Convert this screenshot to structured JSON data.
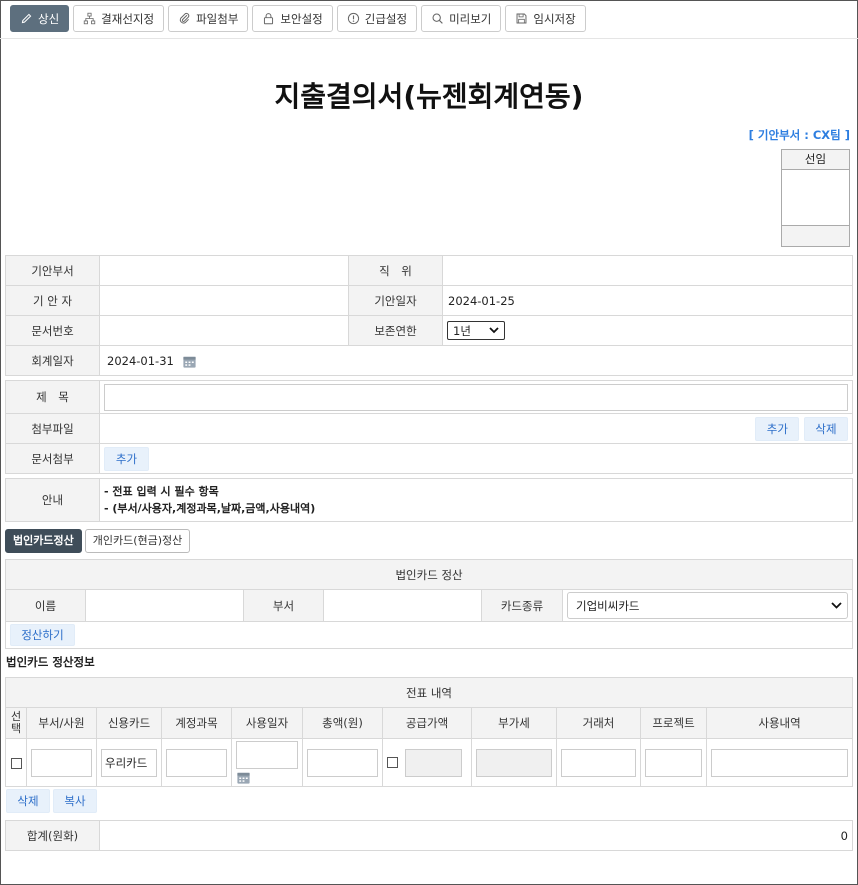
{
  "toolbar": {
    "buttons": [
      {
        "label": "상신",
        "icon": "pencil-icon"
      },
      {
        "label": "결재선지정",
        "icon": "org-chart-icon"
      },
      {
        "label": "파일첨부",
        "icon": "paperclip-icon"
      },
      {
        "label": "보안설정",
        "icon": "lock-icon"
      },
      {
        "label": "긴급설정",
        "icon": "alert-icon"
      },
      {
        "label": "미리보기",
        "icon": "search-icon"
      },
      {
        "label": "임시저장",
        "icon": "save-icon"
      }
    ]
  },
  "document": {
    "title": "지출결의서(뉴젠회계연동)",
    "dept_tag": "[ 기안부서 : CX팀 ]",
    "approval_header": "선임"
  },
  "info": {
    "draft_dept_label": "기안부서",
    "draft_dept_value": "",
    "position_label": "직　위",
    "position_value": "",
    "drafter_label": "기 안 자",
    "drafter_value": "",
    "draft_date_label": "기안일자",
    "draft_date_value": "2024-01-25",
    "doc_no_label": "문서번호",
    "doc_no_value": "",
    "retention_label": "보존연한",
    "retention_value": "1년",
    "acct_date_label": "회계일자",
    "acct_date_value": "2024-01-31"
  },
  "form": {
    "subject_label": "제　목",
    "subject_value": "",
    "attach_label": "첨부파일",
    "attach_add": "추가",
    "attach_delete": "삭제",
    "doc_attach_label": "문서첨부",
    "doc_attach_add": "추가",
    "notice_label": "안내",
    "notice_line1": "- 전표 입력 시 필수 항목",
    "notice_line2": "- (부서/사용자,계정과목,날짜,금액,사용내역)"
  },
  "tabs": {
    "corporate": "법인카드정산",
    "personal": "개인카드(현금)정산"
  },
  "settlement": {
    "header": "법인카드 정산",
    "name_label": "이름",
    "dept_label": "부서",
    "card_type_label": "카드종류",
    "card_type_value": "기업비씨카드",
    "settle_button": "정산하기"
  },
  "voucher": {
    "section_title": "법인카드 정산정보",
    "header": "전표 내역",
    "columns": [
      "선택",
      "부서/사원",
      "신용카드",
      "계정과목",
      "사용일자",
      "총액(원)",
      "공급가액",
      "부가세",
      "거래처",
      "프로젝트",
      "사용내역"
    ],
    "row": {
      "card": "우리카드"
    },
    "delete_button": "삭제",
    "copy_button": "복사",
    "total_label": "합계(원화)",
    "total_value": "0"
  }
}
